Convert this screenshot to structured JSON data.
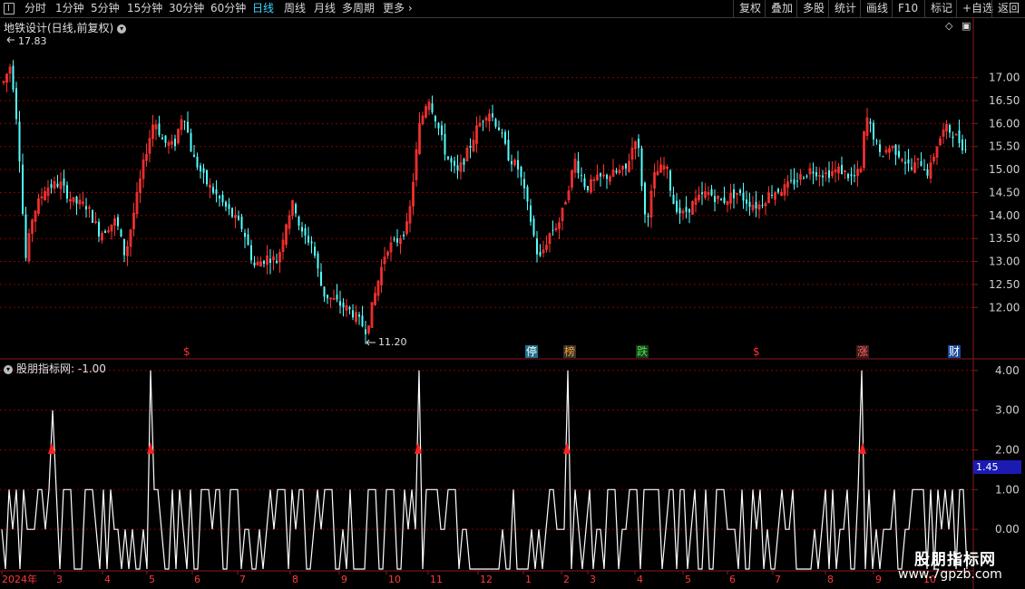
{
  "toolbar": {
    "periods": [
      "分时",
      "1分钟",
      "5分钟",
      "15分钟",
      "30分钟",
      "60分钟",
      "日线",
      "周线",
      "月线",
      "多周期",
      "更多"
    ],
    "active_period": "日线",
    "right_buttons": [
      "复权",
      "叠加",
      "多股",
      "统计",
      "画线",
      "F10",
      "标记",
      "+自选",
      "返回"
    ]
  },
  "main_chart": {
    "title": "地铁设计(日线,前复权)",
    "high_label": "17.83",
    "low_label": "11.20",
    "price_axis": [
      "17.00",
      "16.50",
      "16.00",
      "15.50",
      "15.00",
      "14.50",
      "14.00",
      "13.50",
      "13.00",
      "12.50",
      "12.00"
    ],
    "ylim": [
      11.0,
      17.9
    ],
    "colors": {
      "up": "#ff3232",
      "down": "#54ffff",
      "grid": "#8b0000"
    }
  },
  "events": [
    {
      "text": "$",
      "color": "#ff3030",
      "bg": ""
    },
    {
      "text": "停",
      "color": "#ffffff",
      "bg": "#1f6f8b"
    },
    {
      "text": "榜",
      "color": "#ff9c2a",
      "bg": "#333"
    },
    {
      "text": "跌",
      "color": "#48e048",
      "bg": "#1b3d1b"
    },
    {
      "text": "$",
      "color": "#ff3030",
      "bg": ""
    },
    {
      "text": "涨",
      "color": "#ff6060",
      "bg": "#3d1b1b"
    },
    {
      "text": "财",
      "color": "#ffffff",
      "bg": "#1b4a9b"
    }
  ],
  "indicator": {
    "title": "股朋指标网",
    "value_label": ": -1.00",
    "axis": [
      "4.00",
      "3.00",
      "2.00",
      "1.00",
      "0.00"
    ],
    "ylim": [
      -1.0,
      4.2
    ],
    "highlight_value": "1.45"
  },
  "time_axis": [
    "2024年",
    "3",
    "4",
    "5",
    "6",
    "7",
    "8",
    "9",
    "10",
    "11",
    "12",
    "1",
    "2",
    "3",
    "4",
    "5",
    "6",
    "7",
    "8",
    "9",
    "10"
  ],
  "watermark": {
    "title": "股朋指标网",
    "url": "www.7gpzb.com"
  }
}
